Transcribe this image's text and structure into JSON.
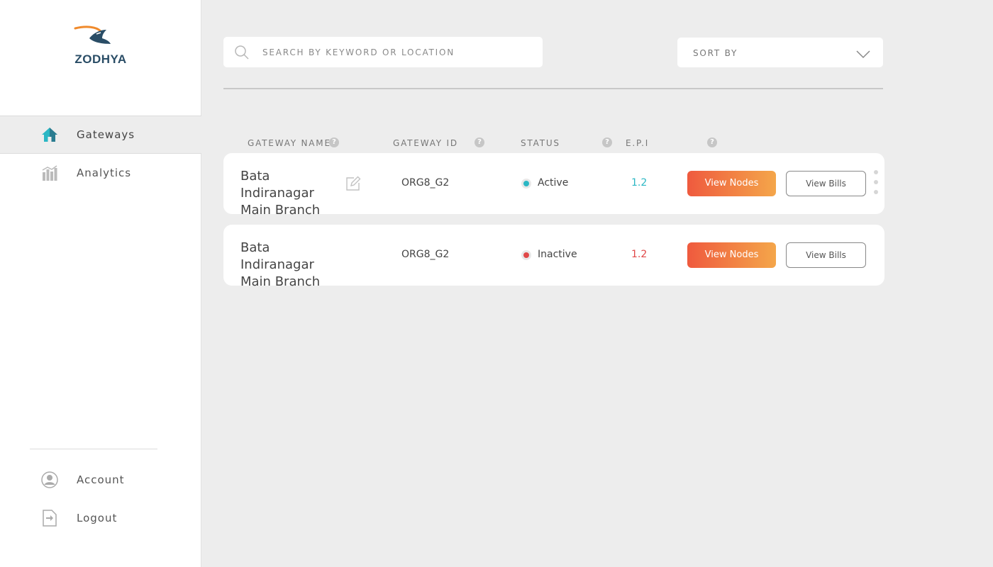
{
  "brand": {
    "logo_text": "ZODHYA"
  },
  "sidebar": {
    "items": [
      {
        "label": "Gateways",
        "icon": "home-icon",
        "active": true
      },
      {
        "label": "Analytics",
        "icon": "bar-chart-icon",
        "active": false
      }
    ],
    "bottom_items": [
      {
        "label": "Account",
        "icon": "user-icon"
      },
      {
        "label": "Logout",
        "icon": "logout-icon"
      }
    ]
  },
  "search": {
    "placeholder": "SEARCH BY KEYWORD OR LOCATION"
  },
  "sort": {
    "label": "SORT BY"
  },
  "table": {
    "headers": [
      "GATEWAY NAME",
      "GATEWAY ID",
      "STATUS",
      "E.P.I"
    ],
    "rows": [
      {
        "name_line1": "Bata Indiranagar",
        "name_line2": "Main Branch",
        "id": "ORG8_G2",
        "status": "Active",
        "epi": "1.2",
        "nodes_label": "View Nodes",
        "bills_label": "View Bills"
      },
      {
        "name_line1": "Bata Indiranagar",
        "name_line2": "Main Branch",
        "id": "ORG8_G2",
        "status": "Inactive",
        "epi": "1.2",
        "nodes_label": "View Nodes",
        "bills_label": "View Bills"
      }
    ]
  },
  "colors": {
    "active_status": "#2bb7c4",
    "inactive_status": "#e04848",
    "accent_start": "#ef5a3e",
    "accent_end": "#f4a64a",
    "logo_blue": "#2a4d66",
    "logo_orange": "#f08a2c"
  }
}
